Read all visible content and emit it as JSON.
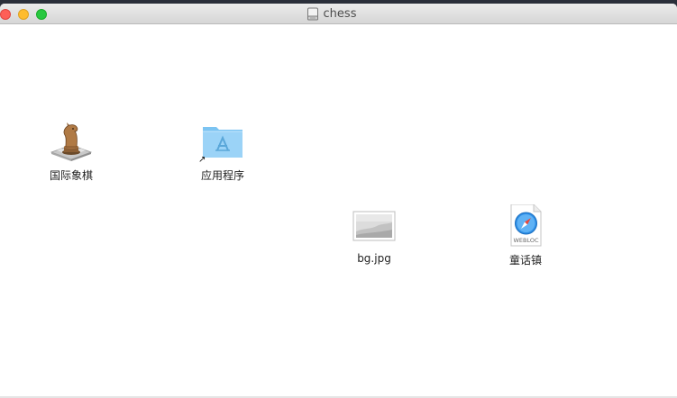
{
  "window": {
    "title": "chess",
    "title_icon": "disk-image-icon"
  },
  "items": [
    {
      "label": "国际象棋",
      "icon": "chess-app-icon"
    },
    {
      "label": "应用程序",
      "icon": "applications-folder-alias-icon"
    },
    {
      "label": "bg.jpg",
      "icon": "image-file-icon"
    },
    {
      "label": "童话镇",
      "icon": "webloc-file-icon",
      "badge": "WEBLOC"
    }
  ],
  "colors": {
    "close": "#fe5f57",
    "minimize": "#febc2e",
    "zoom": "#28c840",
    "folder": "#7cc4f2"
  }
}
